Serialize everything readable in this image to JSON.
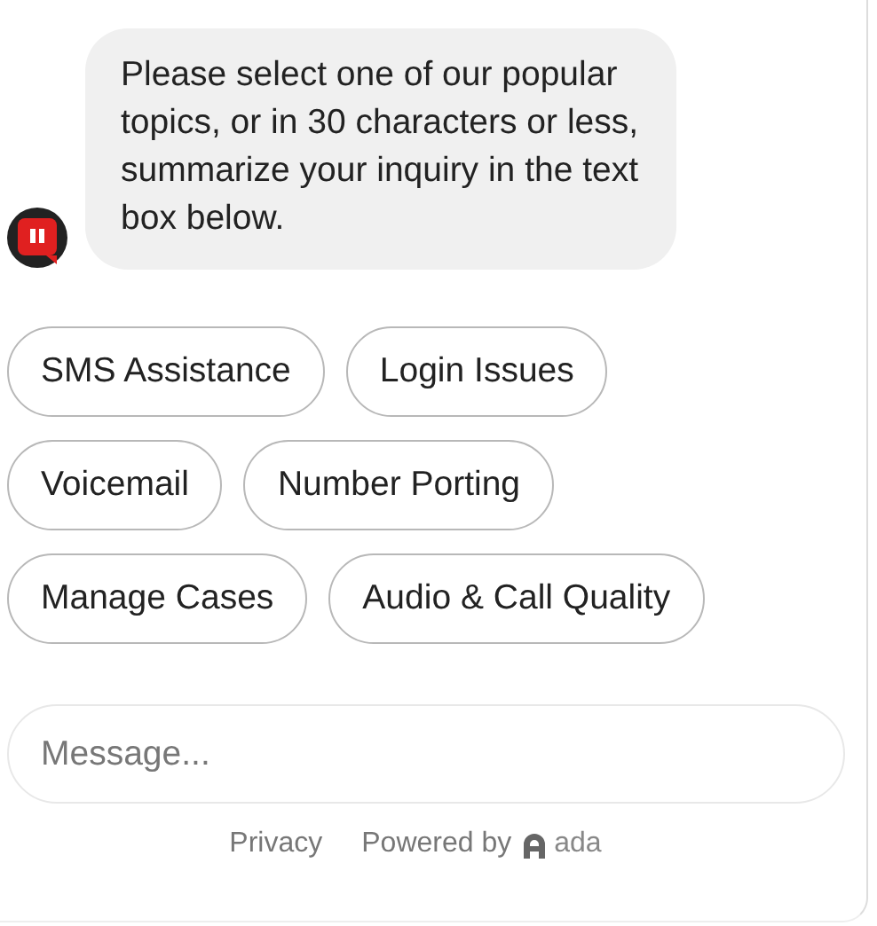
{
  "message": {
    "text": "Please select one of our popular topics, or in 30 characters or less, summarize your inquiry in the text box below."
  },
  "quick_replies": [
    {
      "label": "SMS Assistance"
    },
    {
      "label": "Login Issues"
    },
    {
      "label": "Voicemail"
    },
    {
      "label": "Number Porting"
    },
    {
      "label": "Manage Cases"
    },
    {
      "label": "Audio & Call Quality"
    }
  ],
  "composer": {
    "placeholder": "Message..."
  },
  "footer": {
    "privacy": "Privacy",
    "powered_by": "Powered by",
    "brand": "ada"
  }
}
